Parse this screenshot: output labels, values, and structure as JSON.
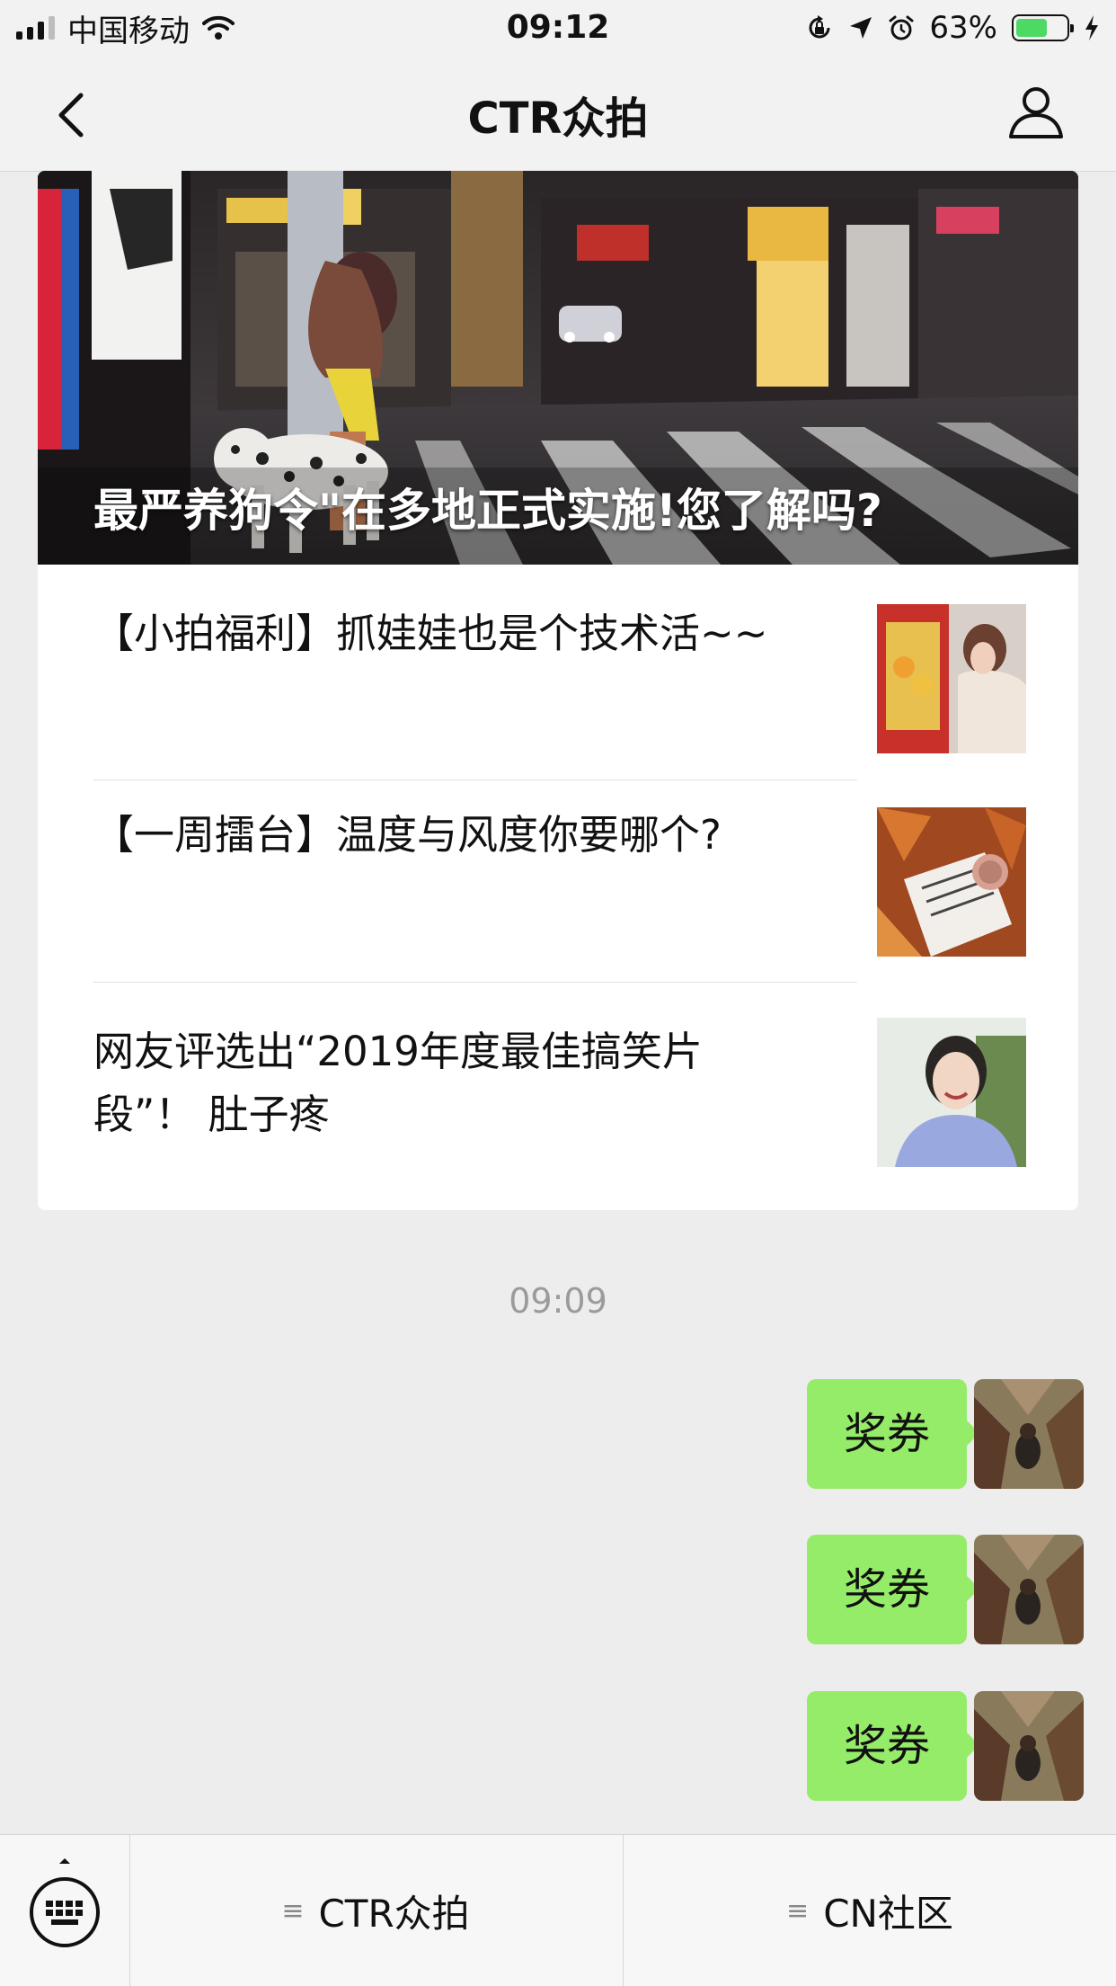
{
  "status_bar": {
    "carrier": "中国移动",
    "time": "09:12",
    "battery_percent_text": "63%",
    "battery_level": 0.63,
    "icons": [
      "signal-icon",
      "wifi-icon",
      "orientation-lock-icon",
      "location-icon",
      "alarm-icon",
      "battery-icon",
      "charging-icon"
    ]
  },
  "nav": {
    "title": "CTR众拍",
    "back_icon": "back-chevron-icon",
    "profile_icon": "person-icon"
  },
  "article_card": {
    "hero": {
      "title": "最严养狗令\"在多地正式实施!您了解吗?"
    },
    "articles": [
      {
        "title": "【小拍福利】抓娃娃也是个技术活~~"
      },
      {
        "title": "【一周擂台】温度与风度你要哪个?"
      },
      {
        "title": "网友评选出“2019年度最佳搞笑片段”！ 肚子疼"
      }
    ]
  },
  "chat": {
    "timestamp": "09:09",
    "messages": [
      {
        "text": "奖券"
      },
      {
        "text": "奖券"
      },
      {
        "text": "奖券"
      }
    ]
  },
  "bottom_menu": {
    "keyboard_icon": "keyboard-icon",
    "items": [
      {
        "label": "CTR众拍"
      },
      {
        "label": "CN社区"
      }
    ]
  },
  "colors": {
    "bubble": "#95ec69",
    "background": "#ededed",
    "battery": "#4cd964"
  }
}
